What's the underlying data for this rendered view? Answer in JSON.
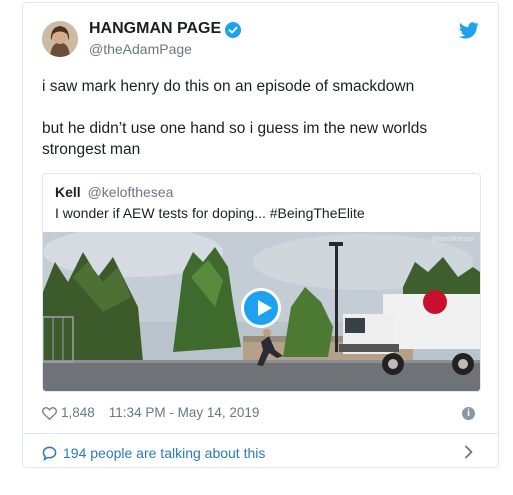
{
  "tweet": {
    "author": {
      "name": "HANGMAN PAGE",
      "handle": "@theAdamPage",
      "avatar_icon": "user-avatar",
      "verified_icon": "verified-badge-icon"
    },
    "platform_icon": "twitter-bird-icon",
    "text": [
      "i saw mark henry do this on an episode of smackdown",
      "but he didn’t use one hand so i guess im the new worlds strongest man"
    ],
    "quoted_tweet": {
      "name": "Kell",
      "handle": "@kelofthesea",
      "text": "I wonder if AEW tests for doping... #BeingTheElite",
      "media_watermark": "@kelofthesea",
      "play_icon": "play-button-icon"
    },
    "likes": "1,848",
    "timestamp": "11:34 PM - May 14, 2019",
    "info_icon": "info-icon",
    "conversation": "194 people are talking about this",
    "colors": {
      "link": "#2b7bb9",
      "brand": "#1da1f2",
      "muted": "#697882",
      "border": "#e1e8ed"
    }
  }
}
